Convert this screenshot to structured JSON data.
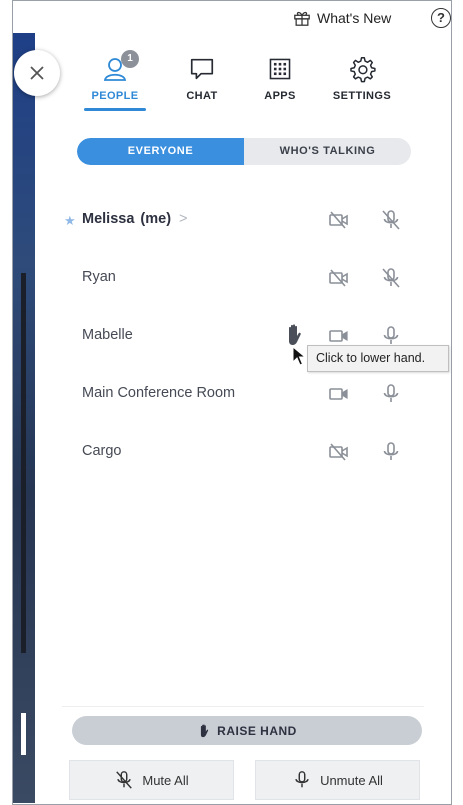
{
  "topbar": {
    "whats_new": "What's New",
    "help": "?"
  },
  "nav": {
    "tabs": [
      {
        "label": "PEOPLE",
        "icon": "people-icon",
        "badge": "1",
        "active": true
      },
      {
        "label": "CHAT",
        "icon": "chat-icon"
      },
      {
        "label": "APPS",
        "icon": "apps-grid-icon"
      },
      {
        "label": "SETTINGS",
        "icon": "gear-icon"
      }
    ]
  },
  "filter": {
    "options": [
      "EVERYONE",
      "WHO'S TALKING"
    ],
    "selected": "EVERYONE"
  },
  "participants": [
    {
      "name": "Melissa",
      "me_label": "(me)",
      "chevron": ">",
      "starred": true,
      "video": "off",
      "audio": "muted"
    },
    {
      "name": "Ryan",
      "video": "off",
      "audio": "muted"
    },
    {
      "name": "Mabelle",
      "video": "on",
      "audio": "on",
      "hand_raised": true
    },
    {
      "name": "Main Conference Room",
      "video": "on",
      "audio": "on"
    },
    {
      "name": "Cargo",
      "video": "off",
      "audio": "on"
    }
  ],
  "tooltip": "Click to lower hand.",
  "bottom": {
    "raise_hand": "RAISE HAND",
    "mute_all": "Mute All",
    "unmute_all": "Unmute All"
  },
  "colors": {
    "accent": "#3b8fdf",
    "icon": "#8a8f98",
    "hand": "#4a4f59"
  }
}
